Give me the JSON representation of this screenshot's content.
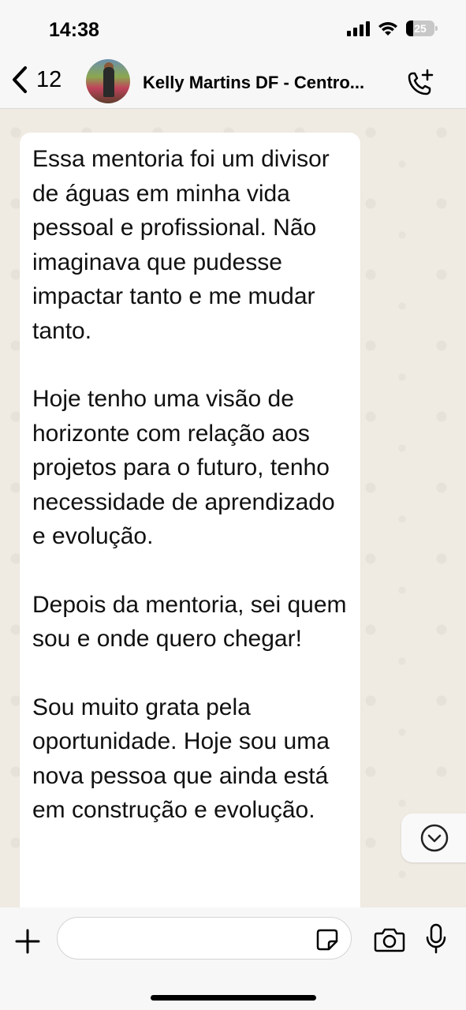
{
  "status_bar": {
    "time": "14:38",
    "battery_level": "25",
    "icons": [
      "cellular-signal-icon",
      "wifi-icon",
      "battery-icon"
    ]
  },
  "header": {
    "back_count": "12",
    "contact_name": "Kelly Martins DF - Centro...",
    "icons": [
      "chevron-left-icon",
      "avatar",
      "add-call-icon"
    ]
  },
  "message": {
    "paragraphs": [
      "Essa mentoria foi um divisor de águas em minha vida pessoal e profissional. Não imaginava que pudesse impactar tanto e me mudar tanto.",
      "Hoje tenho uma visão de horizonte com relação aos projetos para o futuro, tenho necessidade de aprendizado e evolução.",
      "Depois da mentoria, sei quem sou e onde quero chegar!",
      "Sou muito grata pela oportunidade. Hoje sou uma nova pessoa que ainda está em construção e evolução."
    ]
  },
  "input_bar": {
    "message_value": "",
    "icons": [
      "plus-icon",
      "sticker-icon",
      "camera-icon",
      "microphone-icon"
    ]
  },
  "colors": {
    "chat_background": "#efeae2",
    "bubble": "#ffffff",
    "bars": "#f7f7f7",
    "text": "#111111"
  }
}
